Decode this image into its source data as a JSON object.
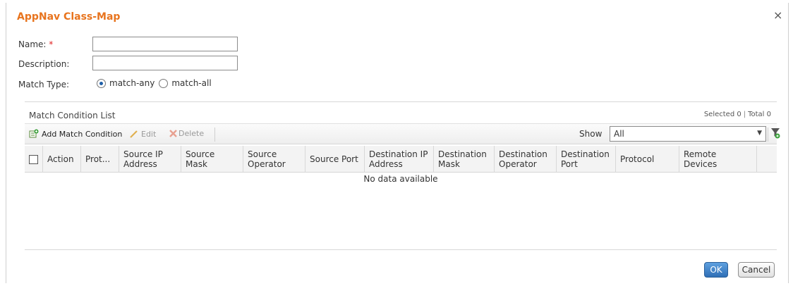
{
  "dialog": {
    "title": "AppNav Class-Map",
    "close_glyph": "×"
  },
  "form": {
    "name_label": "Name:",
    "required_marker": "*",
    "name_value": "",
    "description_label": "Description:",
    "description_value": "",
    "match_type_label": "Match Type:",
    "match_options": [
      "match-any",
      "match-all"
    ],
    "match_selected": "match-any"
  },
  "panel": {
    "title": "Match Condition List",
    "selected_text": "Selected 0",
    "total_text": "Total 0",
    "toolbar": {
      "add_label": "Add Match Condition",
      "edit_label": "Edit",
      "delete_label": "Delete",
      "show_label": "Show",
      "show_value": "All"
    },
    "columns": [
      "",
      "Action",
      "Prot...",
      "Source IP Address",
      "Source Mask",
      "Source Operator",
      "Source Port",
      "Destination IP Address",
      "Destination Mask",
      "Destination Operator",
      "Destination Port",
      "Protocol",
      "Remote Devices"
    ],
    "empty_text": "No data available"
  },
  "footer": {
    "ok_label": "OK",
    "cancel_label": "Cancel"
  },
  "colors": {
    "title": "#e8741e",
    "primary_button": "#2f6fb6",
    "required": "#e02020"
  }
}
